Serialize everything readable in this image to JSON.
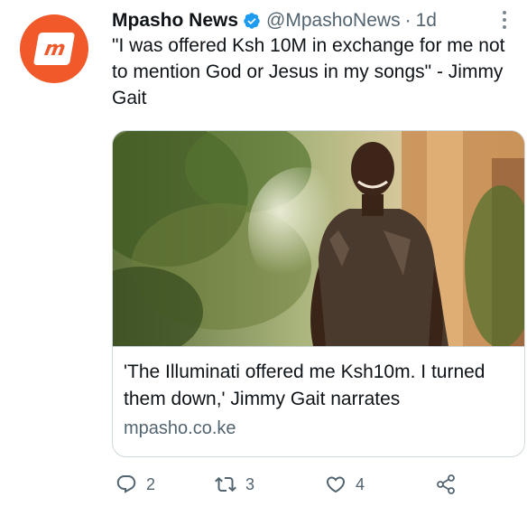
{
  "account": {
    "display_name": "Mpasho News",
    "handle": "@MpashoNews",
    "separator": "·",
    "time": "1d",
    "avatar_logo": "m",
    "brand_color": "#f1592a",
    "verified": true
  },
  "tweet": {
    "text": "\"I was offered Ksh 10M in exchange for me not to mention God or Jesus in my songs\" - Jimmy Gait"
  },
  "card": {
    "title": "'The Illuminati offered me Ksh10m. I turned them down,' Jimmy Gait narrates",
    "domain": "mpasho.co.ke"
  },
  "actions": {
    "replies": "2",
    "retweets": "3",
    "likes": "4"
  },
  "icons": {
    "verified": "verified-badge-icon",
    "more": "more-options-icon",
    "reply": "reply-icon",
    "retweet": "retweet-icon",
    "like": "heart-icon",
    "share": "share-icon"
  },
  "colors": {
    "verified": "#1d9bf0",
    "secondary_text": "#536471",
    "border": "#cfd9de"
  }
}
